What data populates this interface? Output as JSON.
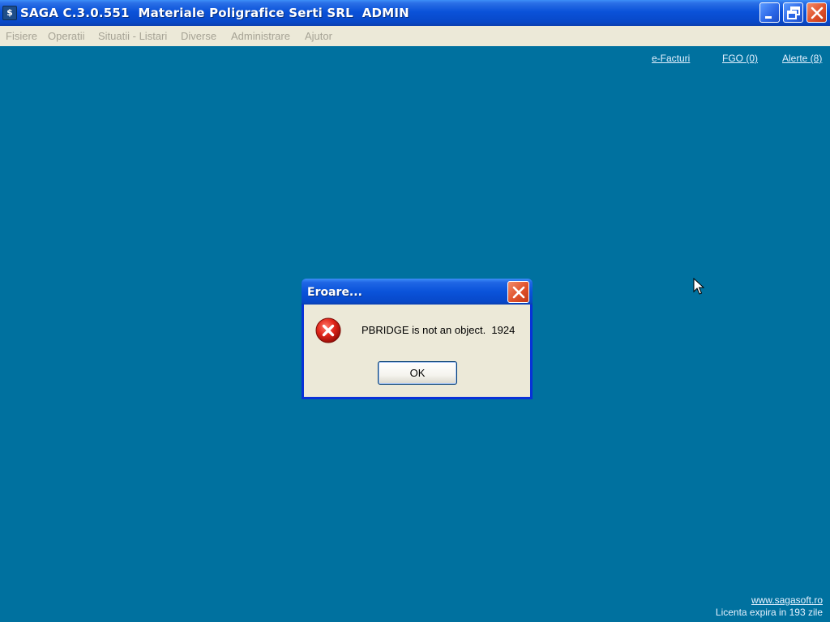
{
  "window": {
    "title": "SAGA C.3.0.551  Materiale Poligrafice Serti SRL  ADMIN",
    "icon_glyph": "$"
  },
  "menu": {
    "items": [
      "Fisiere",
      "Operatii",
      "Situatii - Listari",
      "Diverse",
      "Administrare",
      "Ajutor"
    ]
  },
  "links": {
    "efacturi": "e-Facturi",
    "fgo": "FGO (0)",
    "alerte": "Alerte (8)"
  },
  "footer": {
    "website": "www.sagasoft.ro",
    "license": "Licenta expira in 193 zile"
  },
  "dialog": {
    "title": "Eroare...",
    "message": "PBRIDGE is not an object.  1924",
    "ok_label": "OK",
    "icon": "error-icon"
  },
  "colors": {
    "desktop_background": "#00719f",
    "menubar_background": "#ece9d8",
    "titlebar_blue": "#0a52d9",
    "close_red": "#e0512a"
  }
}
